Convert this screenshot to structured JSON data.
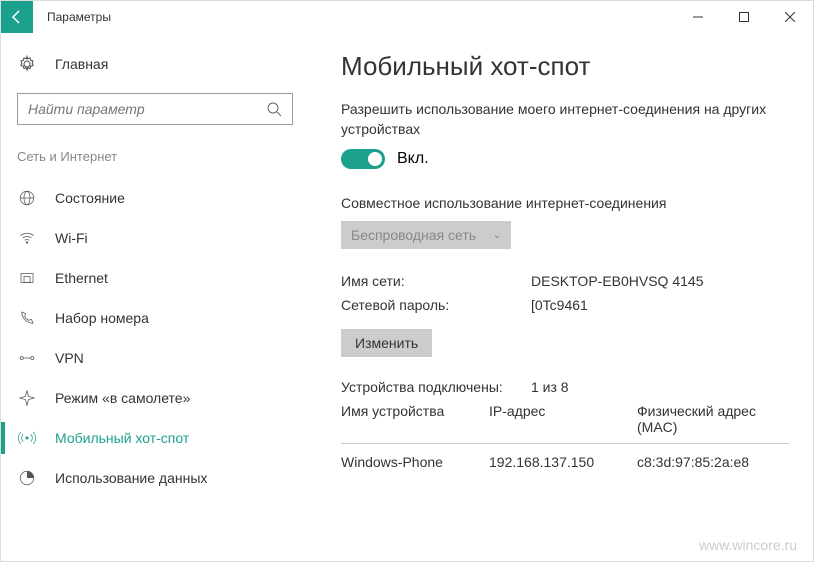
{
  "window_title": "Параметры",
  "sidebar": {
    "home": "Главная",
    "search_placeholder": "Найти параметр",
    "section": "Сеть и Интернет",
    "items": [
      {
        "label": "Состояние"
      },
      {
        "label": "Wi-Fi"
      },
      {
        "label": "Ethernet"
      },
      {
        "label": "Набор номера"
      },
      {
        "label": "VPN"
      },
      {
        "label": "Режим «в самолете»"
      },
      {
        "label": "Мобильный хот-спот"
      },
      {
        "label": "Использование данных"
      }
    ]
  },
  "main": {
    "title": "Мобильный хот-спот",
    "description": "Разрешить использование моего интернет-соединения на других устройствах",
    "toggle_label": "Вкл.",
    "share_label": "Совместное использование интернет-соединения",
    "dropdown_value": "Беспроводная сеть",
    "net_name_label": "Имя сети:",
    "net_name_value": "DESKTOP-EB0HVSQ 4145",
    "net_pass_label": "Сетевой пароль:",
    "net_pass_value": "[0Tc9461",
    "edit_btn": "Изменить",
    "devices_label": "Устройства подключены:",
    "devices_value": "1 из 8",
    "table": {
      "col1": "Имя устройства",
      "col2": "IP-адрес",
      "col3": "Физический адрес (MAC)",
      "row": {
        "c1": "Windows-Phone",
        "c2": "192.168.137.150",
        "c3": "c8:3d:97:85:2a:e8"
      }
    }
  },
  "watermark": "www.wincore.ru"
}
